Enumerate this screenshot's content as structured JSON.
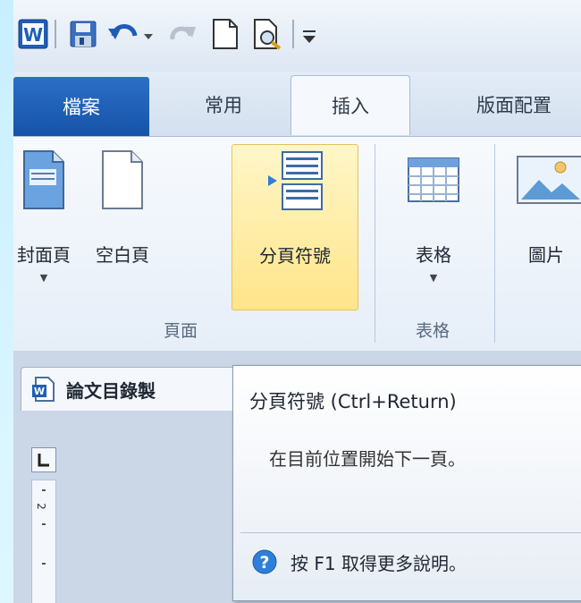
{
  "qat": {
    "icons": [
      "word-app-icon",
      "save-icon",
      "undo-icon",
      "redo-icon",
      "new-document-icon",
      "print-preview-icon",
      "customize-qat-icon"
    ]
  },
  "tabs": [
    {
      "label": "檔案",
      "state": "file"
    },
    {
      "label": "常用",
      "state": "normal"
    },
    {
      "label": "插入",
      "state": "active"
    },
    {
      "label": "版面配置",
      "state": "normal"
    }
  ],
  "ribbon": {
    "groups": [
      {
        "label": "頁面",
        "buttons": [
          {
            "label": "封面頁",
            "has_dropdown": true,
            "icon": "cover-page-icon"
          },
          {
            "label": "空白頁",
            "has_dropdown": false,
            "icon": "blank-page-icon"
          },
          {
            "label": "分頁符號",
            "has_dropdown": false,
            "icon": "page-break-icon",
            "highlighted": true
          }
        ]
      },
      {
        "label": "表格",
        "buttons": [
          {
            "label": "表格",
            "has_dropdown": true,
            "icon": "table-icon"
          }
        ]
      },
      {
        "label": "",
        "buttons": [
          {
            "label": "圖片",
            "has_dropdown": false,
            "icon": "picture-icon"
          }
        ]
      }
    ]
  },
  "document": {
    "tab_title": "論文目錄製",
    "ruler_number": "2"
  },
  "tooltip": {
    "title": "分頁符號 (Ctrl+Return)",
    "description": "在目前位置開始下一頁。",
    "help_text": "按 F1 取得更多說明。"
  },
  "colors": {
    "file_tab": "#1a5cb0",
    "highlight": "#ffe58a",
    "ribbon_bg": "#eef3fa"
  }
}
